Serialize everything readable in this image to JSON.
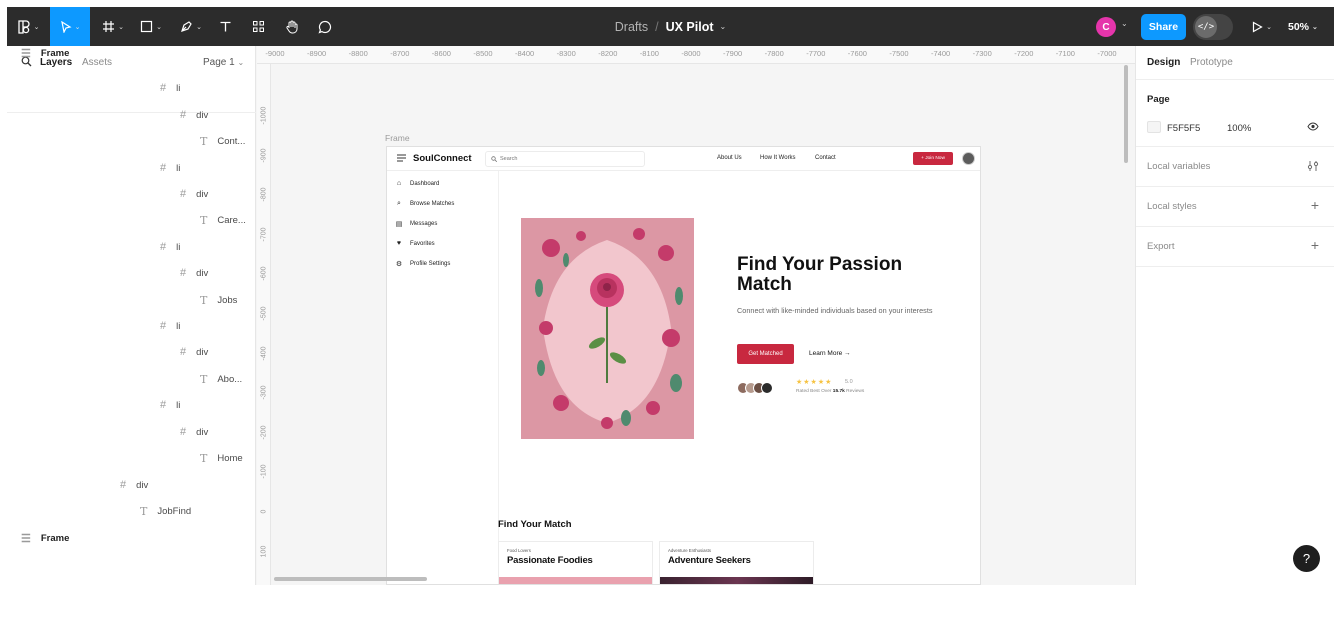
{
  "toolbar": {
    "breadcrumb_drafts": "Drafts",
    "breadcrumb_sep": "/",
    "project_name": "UX Pilot",
    "user_initial": "C",
    "share_label": "Share",
    "zoom_level": "50%",
    "accent_color": "#0d99ff",
    "icons": [
      "figma-menu-icon",
      "move-tool-icon",
      "frame-tool-icon",
      "rectangle-tool-icon",
      "pen-tool-icon",
      "text-tool-icon",
      "components-icon",
      "hand-tool-icon",
      "comment-icon",
      "dev-mode-icon",
      "present-icon"
    ]
  },
  "left_panel": {
    "search_icon": "search-icon",
    "tab_layers": "Layers",
    "tab_assets": "Assets",
    "page_selector": "Page 1",
    "layers": [
      {
        "type": "frame",
        "name": "Frame",
        "bold": true
      },
      {
        "type": "grid",
        "name": "li"
      },
      {
        "type": "grid",
        "name": "div"
      },
      {
        "type": "text",
        "name": "Cont..."
      },
      {
        "type": "grid",
        "name": "li"
      },
      {
        "type": "grid",
        "name": "div"
      },
      {
        "type": "text",
        "name": "Care..."
      },
      {
        "type": "grid",
        "name": "li"
      },
      {
        "type": "grid",
        "name": "div"
      },
      {
        "type": "text",
        "name": "Jobs"
      },
      {
        "type": "grid",
        "name": "li"
      },
      {
        "type": "grid",
        "name": "div"
      },
      {
        "type": "text",
        "name": "Abo..."
      },
      {
        "type": "grid",
        "name": "li"
      },
      {
        "type": "grid",
        "name": "div"
      },
      {
        "type": "text",
        "name": "Home"
      },
      {
        "type": "grid",
        "name": "div"
      },
      {
        "type": "text",
        "name": "JobFind"
      },
      {
        "type": "frame",
        "name": "Frame",
        "bold": true
      }
    ]
  },
  "rulers": {
    "top": [
      "-9000",
      "-8900",
      "-8800",
      "-8700",
      "-8600",
      "-8500",
      "-8400",
      "-8300",
      "-8200",
      "-8100",
      "-8000",
      "-7900",
      "-7800",
      "-7700",
      "-7600",
      "-7500",
      "-7400",
      "-7300",
      "-7200",
      "-7100",
      "-7000"
    ],
    "left": [
      "-1000",
      "-900",
      "-800",
      "-700",
      "-600",
      "-500",
      "-400",
      "-300",
      "-200",
      "-100",
      "0",
      "100"
    ]
  },
  "canvas": {
    "frame_label": "Frame",
    "design": {
      "logo": "SoulConnect",
      "search_placeholder": "Search",
      "nav_links": [
        "About Us",
        "How It Works",
        "Contact"
      ],
      "join_button": "+ Join Now",
      "sidebar": [
        {
          "icon": "home-icon",
          "label": "Dashboard"
        },
        {
          "icon": "search-icon",
          "label": "Browse Matches"
        },
        {
          "icon": "message-icon",
          "label": "Messages"
        },
        {
          "icon": "heart-icon",
          "label": "Favorites"
        },
        {
          "icon": "gear-icon",
          "label": "Profile Settings"
        }
      ],
      "hero_title": "Find Your Passion Match",
      "hero_subtitle": "Connect with like-minded individuals based on your interests",
      "cta_primary": "Get Matched",
      "cta_secondary": "Learn More →",
      "rating_stars": "★★★★★",
      "rating_value": "5.0",
      "rated_prefix": "Rated Best Over ",
      "rated_count": "15.7k",
      "rated_suffix": " Reviews",
      "section_title": "Find Your Match",
      "cards": [
        {
          "tag": "Food Lovers",
          "title": "Passionate Foodies"
        },
        {
          "tag": "Adventure Enthusiasts",
          "title": "Adventure Seekers"
        }
      ],
      "brand_color": "#c8283f"
    }
  },
  "right_panel": {
    "tab_design": "Design",
    "tab_prototype": "Prototype",
    "page_section": "Page",
    "page_color": "F5F5F5",
    "page_opacity": "100%",
    "local_variables": "Local variables",
    "local_styles": "Local styles",
    "export": "Export",
    "help": "?"
  }
}
